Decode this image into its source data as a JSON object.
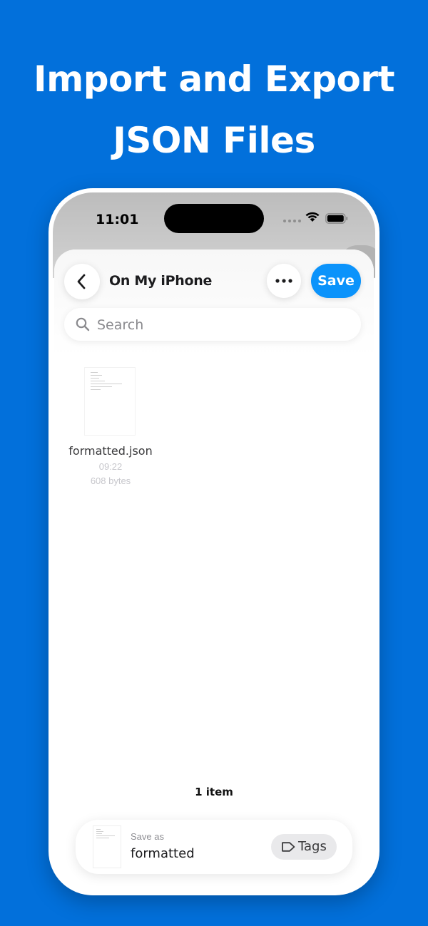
{
  "headline": {
    "line1": "Import and Export",
    "line2": "JSON Files"
  },
  "status_bar": {
    "time": "11:01",
    "icons": [
      "signal-dots-icon",
      "wifi-icon",
      "battery-icon"
    ]
  },
  "header": {
    "back_icon": "chevron-left-icon",
    "location": "On My iPhone",
    "more_icon": "ellipsis-icon",
    "save_label": "Save"
  },
  "search": {
    "placeholder": "Search",
    "value": ""
  },
  "files": [
    {
      "name": "formatted.json",
      "time": "09:22",
      "size": "608 bytes"
    }
  ],
  "footer": {
    "item_count": "1 item",
    "save_as_label": "Save as",
    "filename": "formatted",
    "tags_label": "Tags",
    "tags_icon": "tag-icon"
  },
  "colors": {
    "background": "#0270DB",
    "save_button": "#0B93FB",
    "headline_text": "#FFFFFF"
  }
}
